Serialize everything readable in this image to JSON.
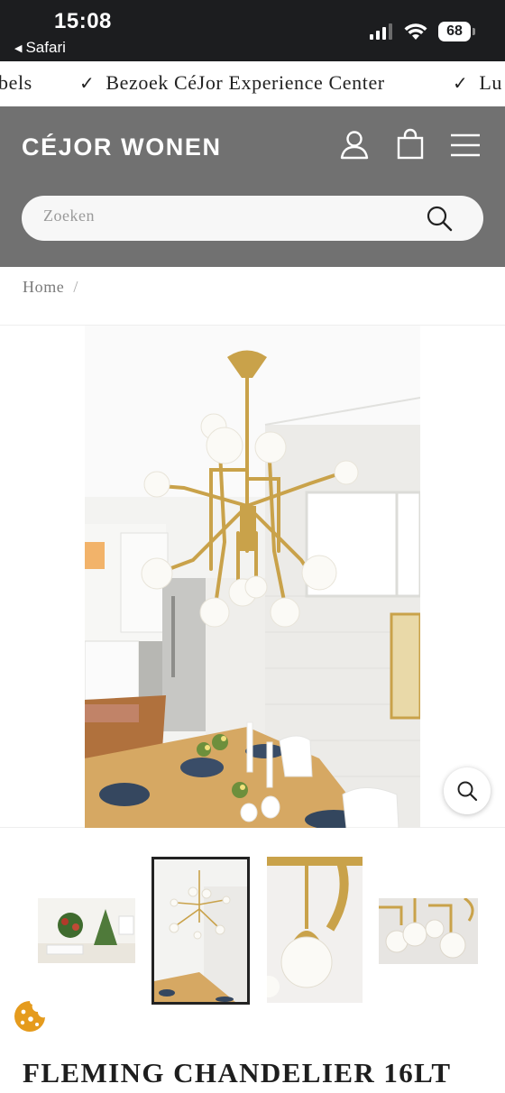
{
  "status_bar": {
    "time": "15:08",
    "back_app": "Safari",
    "battery": "68"
  },
  "announcements": [
    {
      "text": "bels"
    },
    {
      "text": "Bezoek CéJor Experience Center"
    },
    {
      "text": "Lu"
    }
  ],
  "header": {
    "logo": "CÉJOR WONEN",
    "icons": [
      "account-icon",
      "cart-icon",
      "menu-icon"
    ],
    "background": "#717171"
  },
  "search": {
    "placeholder": "Zoeken"
  },
  "breadcrumb": {
    "home": "Home",
    "separator": "/"
  },
  "gallery": {
    "thumbnail_count": 4,
    "active_index": 1,
    "thumbnails": [
      "living-room-christmas-thumbnail",
      "dining-room-chandelier-thumbnail",
      "globe-detail-thumbnail",
      "chandelier-closeup-thumbnail"
    ]
  },
  "product": {
    "title": "FLEMING CHANDELIER 16LT"
  },
  "colors": {
    "brass": "#c9a24a",
    "header_gray": "#717171",
    "status_bar": "#1c1d1f"
  }
}
